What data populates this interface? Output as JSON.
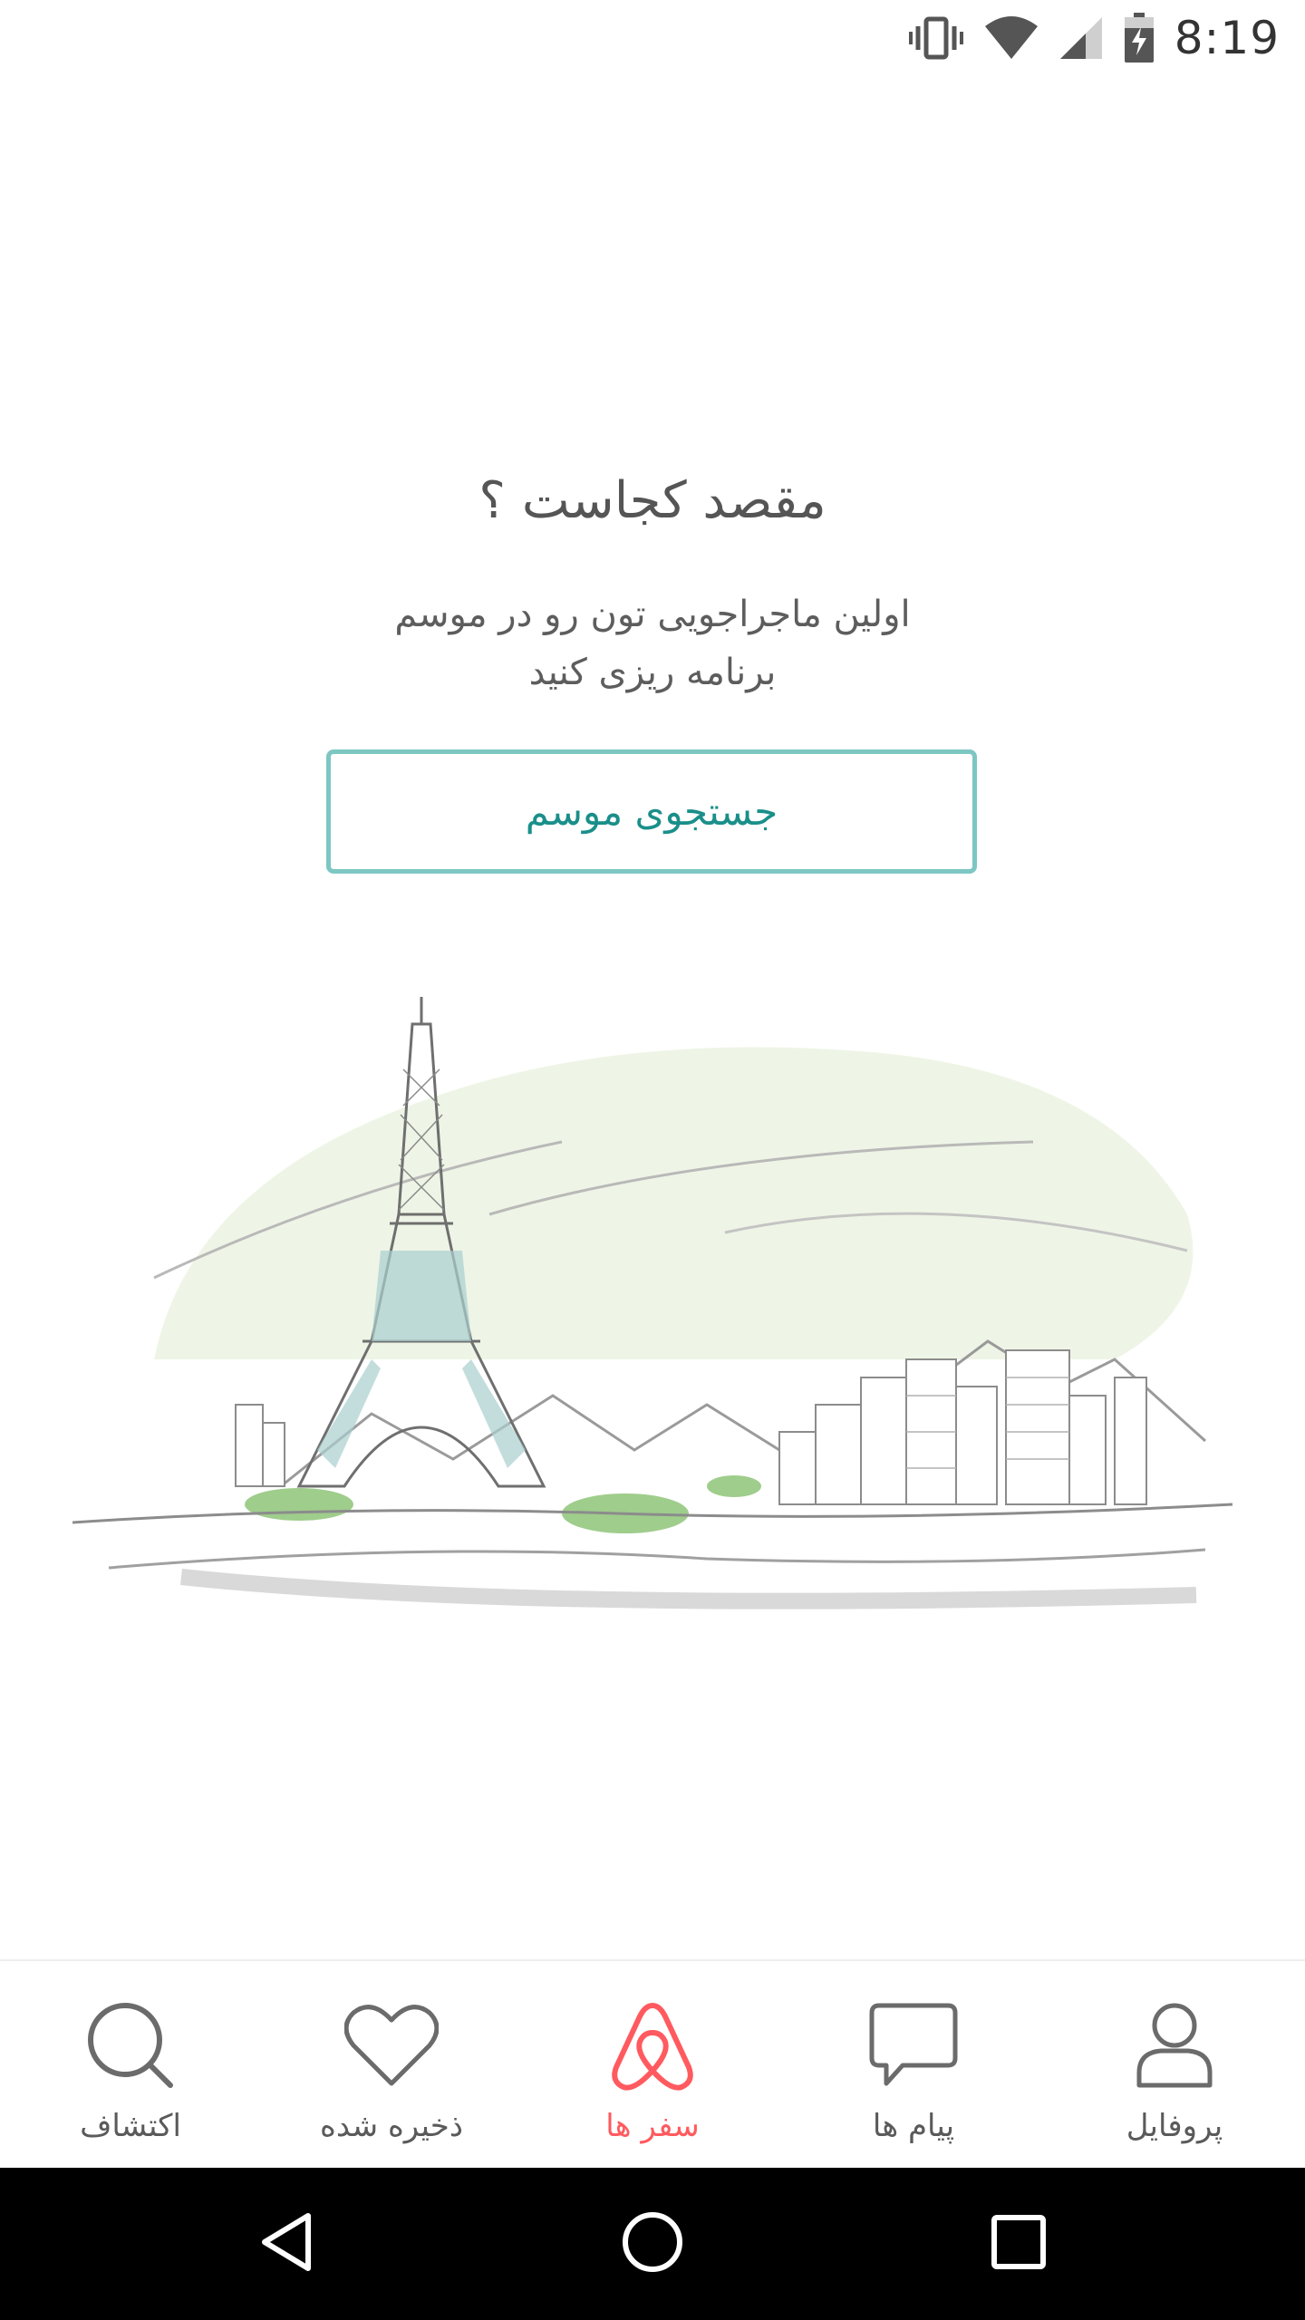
{
  "status_bar": {
    "time": "8:19",
    "icons": [
      "vibrate-icon",
      "wifi-icon",
      "cell-signal-icon",
      "battery-charging-icon"
    ]
  },
  "empty_state": {
    "title": "مقصد کجاست ؟",
    "subtitle_line1": "اولین  ماجراجویی تون رو در موسم",
    "subtitle_line2": "برنامه ریزی کنید",
    "search_button_label": "جستجوی موسم"
  },
  "illustration": {
    "name": "paris-eiffel-tower-illustration"
  },
  "bottom_nav": {
    "items": [
      {
        "label": "اکتشاف",
        "icon": "search-icon",
        "active": false
      },
      {
        "label": "ذخیره شده",
        "icon": "heart-icon",
        "active": false
      },
      {
        "label": "سفر ها",
        "icon": "airbnb-logo-icon",
        "active": true
      },
      {
        "label": "پیام ها",
        "icon": "message-icon",
        "active": false
      },
      {
        "label": "پروفایل",
        "icon": "profile-icon",
        "active": false
      }
    ]
  },
  "system_nav": {
    "buttons": [
      "back-icon",
      "home-icon",
      "recents-icon"
    ]
  },
  "colors": {
    "accent": "#ff5a5f",
    "teal": "#1a8f8a",
    "teal_border": "#7dc7c3"
  }
}
